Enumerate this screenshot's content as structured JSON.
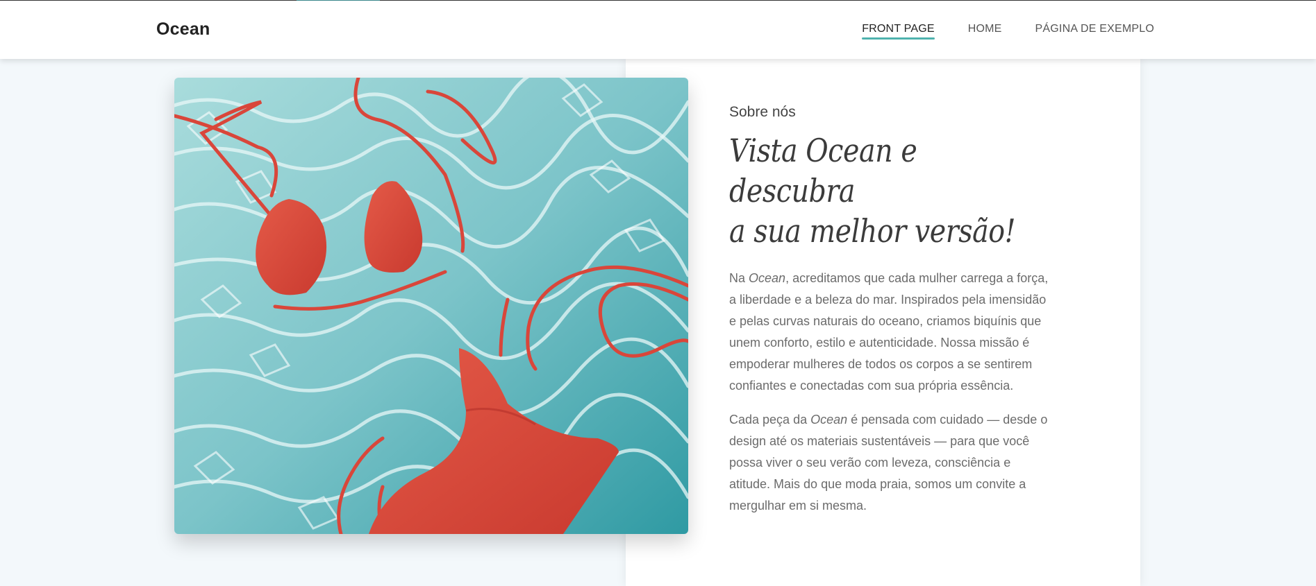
{
  "header": {
    "brand": "Ocean",
    "nav": [
      {
        "label": "FRONT PAGE",
        "active": true
      },
      {
        "label": "HOME",
        "active": false
      },
      {
        "label": "PÁGINA DE EXEMPLO",
        "active": false
      }
    ]
  },
  "about": {
    "eyebrow": "Sobre nós",
    "headline_line1": "Vista Ocean e descubra",
    "headline_line2": "a sua melhor versão!",
    "para1_prefix": "Na ",
    "para1_brand": "Ocean",
    "para1_text": ", acreditamos que cada mulher carrega a força, a liberdade e a beleza do mar. Inspirados pela imensidão e pelas curvas naturais do oceano, criamos biquínis que unem conforto, estilo e autenticidade. Nossa missão é empoderar mulheres de todos os corpos a se sentirem confiantes e conectadas com sua própria essência.",
    "para2_prefix": "Cada peça da ",
    "para2_brand": "Ocean",
    "para2_text": " é pensada com cuidado — desde o design até os materiais sustentáveis — para que você possa viver o seu verão com leveza, consciência e atitude. Mais do que moda praia, somos um convite a mergulhar em si mesma."
  },
  "image": {
    "icon": "bikini-in-pool-photo",
    "water_color": "#7cc4c9",
    "bikini_color": "#d9463a"
  },
  "colors": {
    "accent": "#4fb3ae",
    "background": "#f3f8fb"
  }
}
